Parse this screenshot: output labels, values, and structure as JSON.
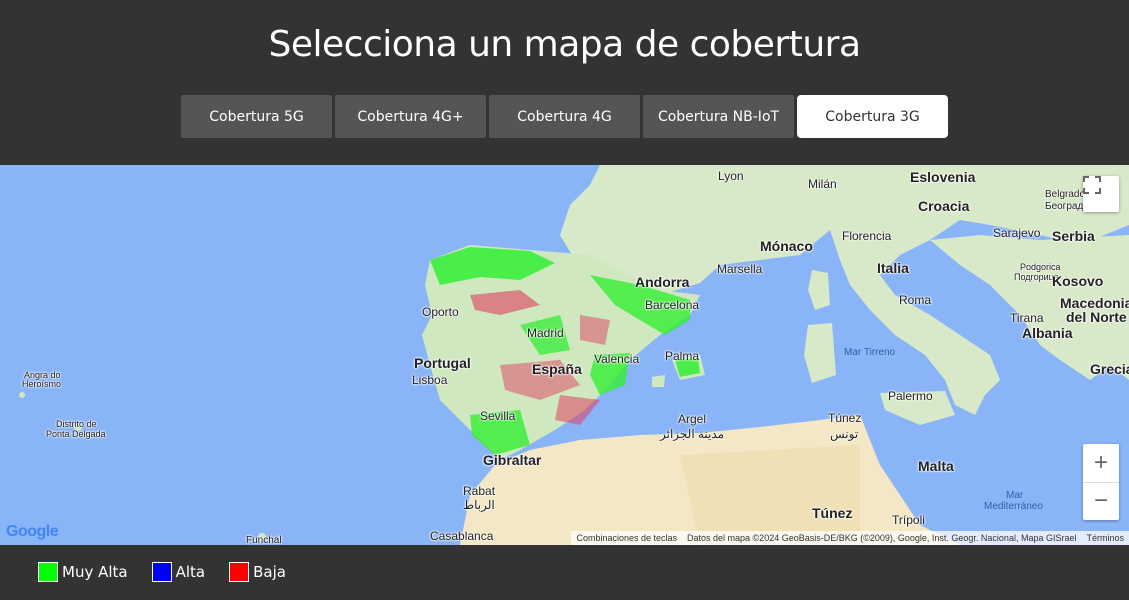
{
  "header": {
    "title": "Selecciona un mapa de cobertura",
    "tabs": [
      {
        "label": "Cobertura 5G",
        "active": false
      },
      {
        "label": "Cobertura 4G+",
        "active": false
      },
      {
        "label": "Cobertura 4G",
        "active": false
      },
      {
        "label": "Cobertura NB-IoT",
        "active": false
      },
      {
        "label": "Cobertura 3G",
        "active": true
      }
    ]
  },
  "map": {
    "labels": {
      "lyon": "Lyon",
      "milan": "Milán",
      "eslovenia": "Eslovenia",
      "belgrado": "Belgrado",
      "belgrado_cyr": "Београд",
      "croacia": "Croacia",
      "sarajevo": "Sarajevo",
      "serbia": "Serbia",
      "monaco": "Mónaco",
      "florencia": "Florencia",
      "marsella": "Marsella",
      "italia": "Italia",
      "andorra": "Andorra",
      "barcelona": "Barcelona",
      "roma": "Roma",
      "podgorica": "Podgorica",
      "podgorica_cyr": "Подгорица",
      "kosovo": "Kosovo",
      "macedonia": "Macedonia",
      "del_norte": "del Norte",
      "tirana": "Tirana",
      "albania": "Albania",
      "mar_mediterraneo_label": "Mar Mediterráneo",
      "oporto": "Oporto",
      "madrid": "Madrid",
      "valencia": "Valencia",
      "palma": "Palma",
      "mar_tirreno": "Mar Tirreno",
      "portugal": "Portugal",
      "lisboa": "Lisboa",
      "espana": "España",
      "grecia": "Grecia",
      "angra": "Angra do",
      "heroismo": "Heroísmo",
      "distrito": "Distrito de",
      "ponta": "Ponta Delgada",
      "sevilla": "Sevilla",
      "argel": "Argel",
      "argel_ar": "مدينة الجزائر",
      "tunez_city": "Túnez",
      "tunez_ar": "تونس",
      "palermo": "Palermo",
      "gibraltar": "Gibraltar",
      "malta": "Malta",
      "rabat": "Rabat",
      "rabat_ar": "الرباط",
      "mar": "Mar",
      "mediterraneo": "Mediterráneo",
      "tunez_country": "Túnez",
      "tripoli": "Trípoli",
      "funchal": "Funchal",
      "casablanca": "Casablanca"
    },
    "attribution": {
      "shortcuts": "Combinaciones de teclas",
      "data": "Datos del mapa ©2024 GeoBasis-DE/BKG (©2009), Google, Inst. Geogr. Nacional, Mapa GISrael",
      "terms": "Términos"
    },
    "google_logo": "Google",
    "controls": {
      "zoom_in": "+",
      "zoom_out": "−"
    }
  },
  "legend": [
    {
      "label": "Muy Alta",
      "color": "#00ff00"
    },
    {
      "label": "Alta",
      "color": "#0000ff"
    },
    {
      "label": "Baja",
      "color": "#ff0000"
    }
  ],
  "colors": {
    "background": "#333333",
    "tab": "#555555",
    "tab_active": "#ffffff",
    "sea": "#8ab4f8",
    "land": "#cfe8c0"
  }
}
